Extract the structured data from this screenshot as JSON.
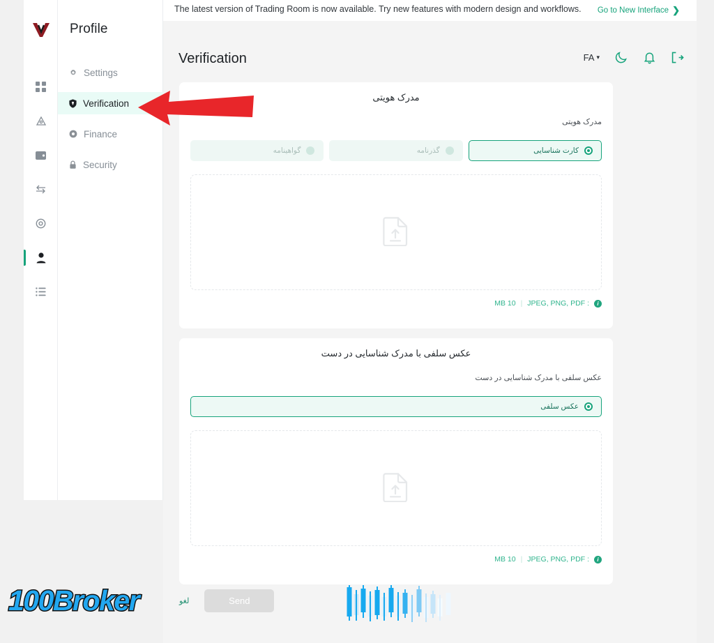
{
  "banner": {
    "message": "The latest version of Trading Room is now available. Try new features with modern design and workflows.",
    "cta": "Go to New Interface",
    "chevron": "❯"
  },
  "rail": {
    "logo_alt": "broker-logo",
    "items": [
      {
        "name": "dashboard",
        "active": false
      },
      {
        "name": "deposit",
        "active": false
      },
      {
        "name": "wallet",
        "active": false
      },
      {
        "name": "transfer",
        "active": false
      },
      {
        "name": "trade",
        "active": false
      },
      {
        "name": "profile",
        "active": true
      },
      {
        "name": "reports",
        "active": false
      }
    ]
  },
  "sidebar": {
    "title": "Profile",
    "items": [
      {
        "label": "Settings",
        "icon": "gear-icon",
        "active": false
      },
      {
        "label": "Verification",
        "icon": "shield-icon",
        "active": true
      },
      {
        "label": "Finance",
        "icon": "coin-icon",
        "active": false
      },
      {
        "label": "Security",
        "icon": "lock-icon",
        "active": false
      }
    ]
  },
  "header": {
    "title": "Verification",
    "language": "FA",
    "language_caret": "▾",
    "icons": [
      "moon-icon",
      "bell-icon",
      "logout-icon"
    ]
  },
  "cards": [
    {
      "title": "مدرک هویتی",
      "subtitle": "مدرک هویتی",
      "options": [
        {
          "label": "کارت شناسایی",
          "selected": true
        },
        {
          "label": "گذرنامه",
          "selected": false
        },
        {
          "label": "گواهینامه",
          "selected": false
        }
      ],
      "dropzone_icon": "file-upload-icon",
      "hint_formats": ": JPEG, PNG, PDF",
      "hint_separator": "|",
      "hint_size": "10 MB"
    },
    {
      "title": "عکس سلفی با مدرک شناسایی در دست",
      "subtitle": "عکس سلفی با مدرک شناسایی در دست",
      "options": [
        {
          "label": "عکس سلفی",
          "selected": true
        }
      ],
      "dropzone_icon": "file-upload-icon",
      "hint_formats": ": JPEG, PNG, PDF",
      "hint_separator": "|",
      "hint_size": "10 MB"
    }
  ],
  "actions": {
    "send_label": "Send",
    "cancel_label": "لغو"
  },
  "watermark": {
    "brand_100": "100",
    "brand_broker": "Broker"
  },
  "annotation": {
    "arrow": "red-left-arrow"
  },
  "colors": {
    "accent": "#16a37b",
    "accent_soft": "#e9fbf6",
    "page_bg": "#f4f4f4",
    "card_bg": "#ffffff",
    "muted": "#868e96",
    "watermark_blue": "#22a7f0",
    "annotation_red": "#e8262a"
  }
}
